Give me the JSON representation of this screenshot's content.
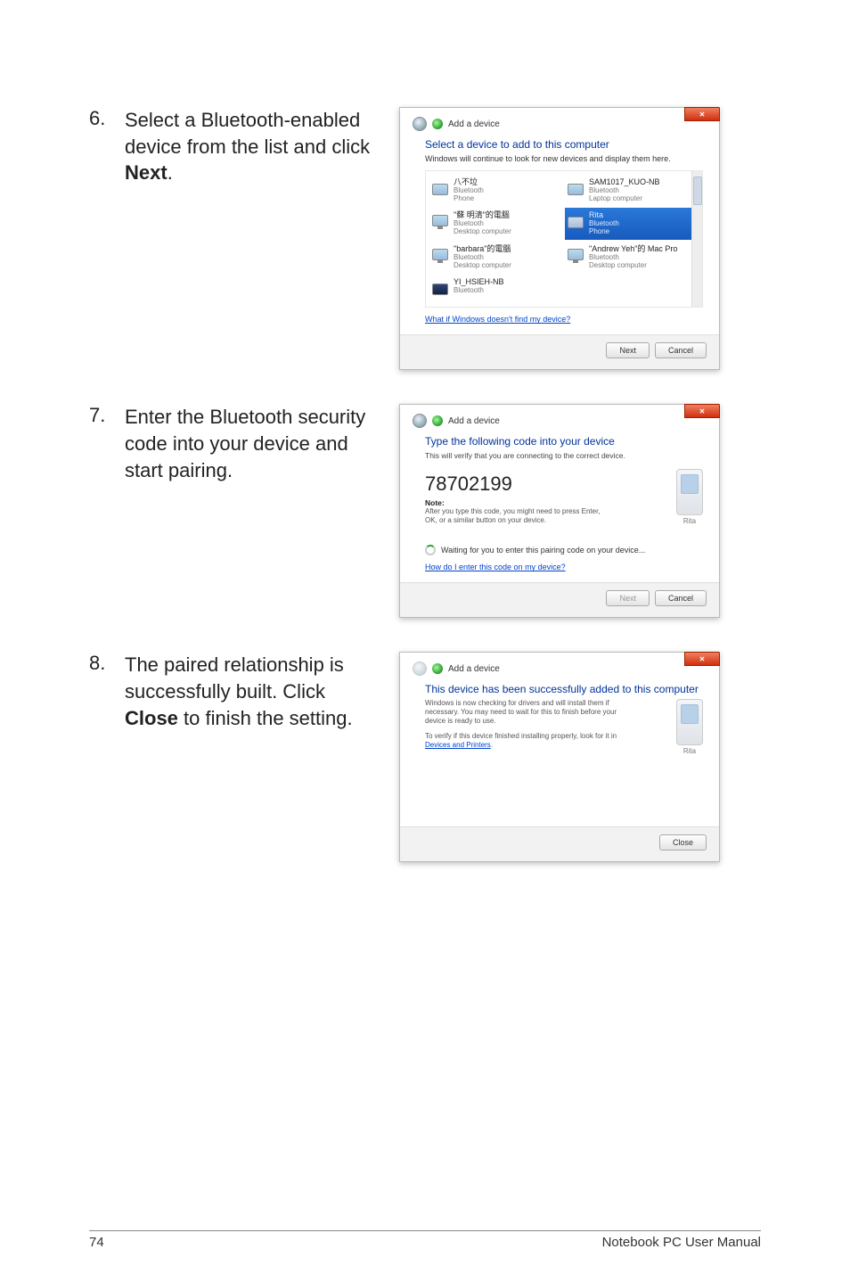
{
  "steps": {
    "s6": {
      "num": "6.",
      "text_pre": "Select a Bluetooth-enabled device from the list and click ",
      "text_bold": "Next",
      "text_post": "."
    },
    "s7": {
      "num": "7.",
      "text": "Enter the Bluetooth security code into your device and start pairing."
    },
    "s8": {
      "num": "8.",
      "text_pre": "The paired relationship is successfully built. Click ",
      "text_bold": "Close",
      "text_post": " to finish the setting."
    }
  },
  "dialog1": {
    "window_label": "Add a device",
    "title": "Select a device to add to this computer",
    "subtitle": "Windows will continue to look for new devices and display them here.",
    "devices": [
      {
        "name": "八不垃",
        "type": "Bluetooth",
        "kind": "Phone"
      },
      {
        "name": "SAM1017_KUO-NB",
        "type": "Bluetooth",
        "kind": "Laptop computer"
      },
      {
        "name": "\"蘇 明清\"的電腦",
        "type": "Bluetooth",
        "kind": "Desktop computer"
      },
      {
        "name": "Rita",
        "type": "Bluetooth",
        "kind": "Phone",
        "selected": true
      },
      {
        "name": "\"barbara\"的電腦",
        "type": "Bluetooth",
        "kind": "Desktop computer"
      },
      {
        "name": "\"Andrew Yeh\"的 Mac Pro",
        "type": "Bluetooth",
        "kind": "Desktop computer"
      },
      {
        "name": "YI_HSIEH-NB",
        "type": "Bluetooth",
        "kind": ""
      }
    ],
    "help_link": "What if Windows doesn't find my device?",
    "next_btn": "Next",
    "cancel_btn": "Cancel"
  },
  "dialog2": {
    "window_label": "Add a device",
    "title": "Type the following code into your device",
    "subtitle": "This will verify that you are connecting to the correct device.",
    "code": "78702199",
    "note_label": "Note:",
    "note_text": "After you type this code, you might need to press Enter, OK, or a similar button on your device.",
    "waiting": "Waiting for you to enter this pairing code on your device...",
    "help_link": "How do I enter this code on my device?",
    "phone_caption": "Rita",
    "next_btn": "Next",
    "cancel_btn": "Cancel"
  },
  "dialog3": {
    "window_label": "Add a device",
    "title": "This device has been successfully added to this computer",
    "body1": "Windows is now checking for drivers and will install them if necessary. You may need to wait for this to finish before your device is ready to use.",
    "body2_pre": "To verify if this device finished installing properly, look for it in ",
    "body2_link": "Devices and Printers",
    "body2_post": ".",
    "phone_caption": "Rita",
    "close_btn": "Close"
  },
  "footer": {
    "page": "74",
    "label": "Notebook PC User Manual"
  }
}
